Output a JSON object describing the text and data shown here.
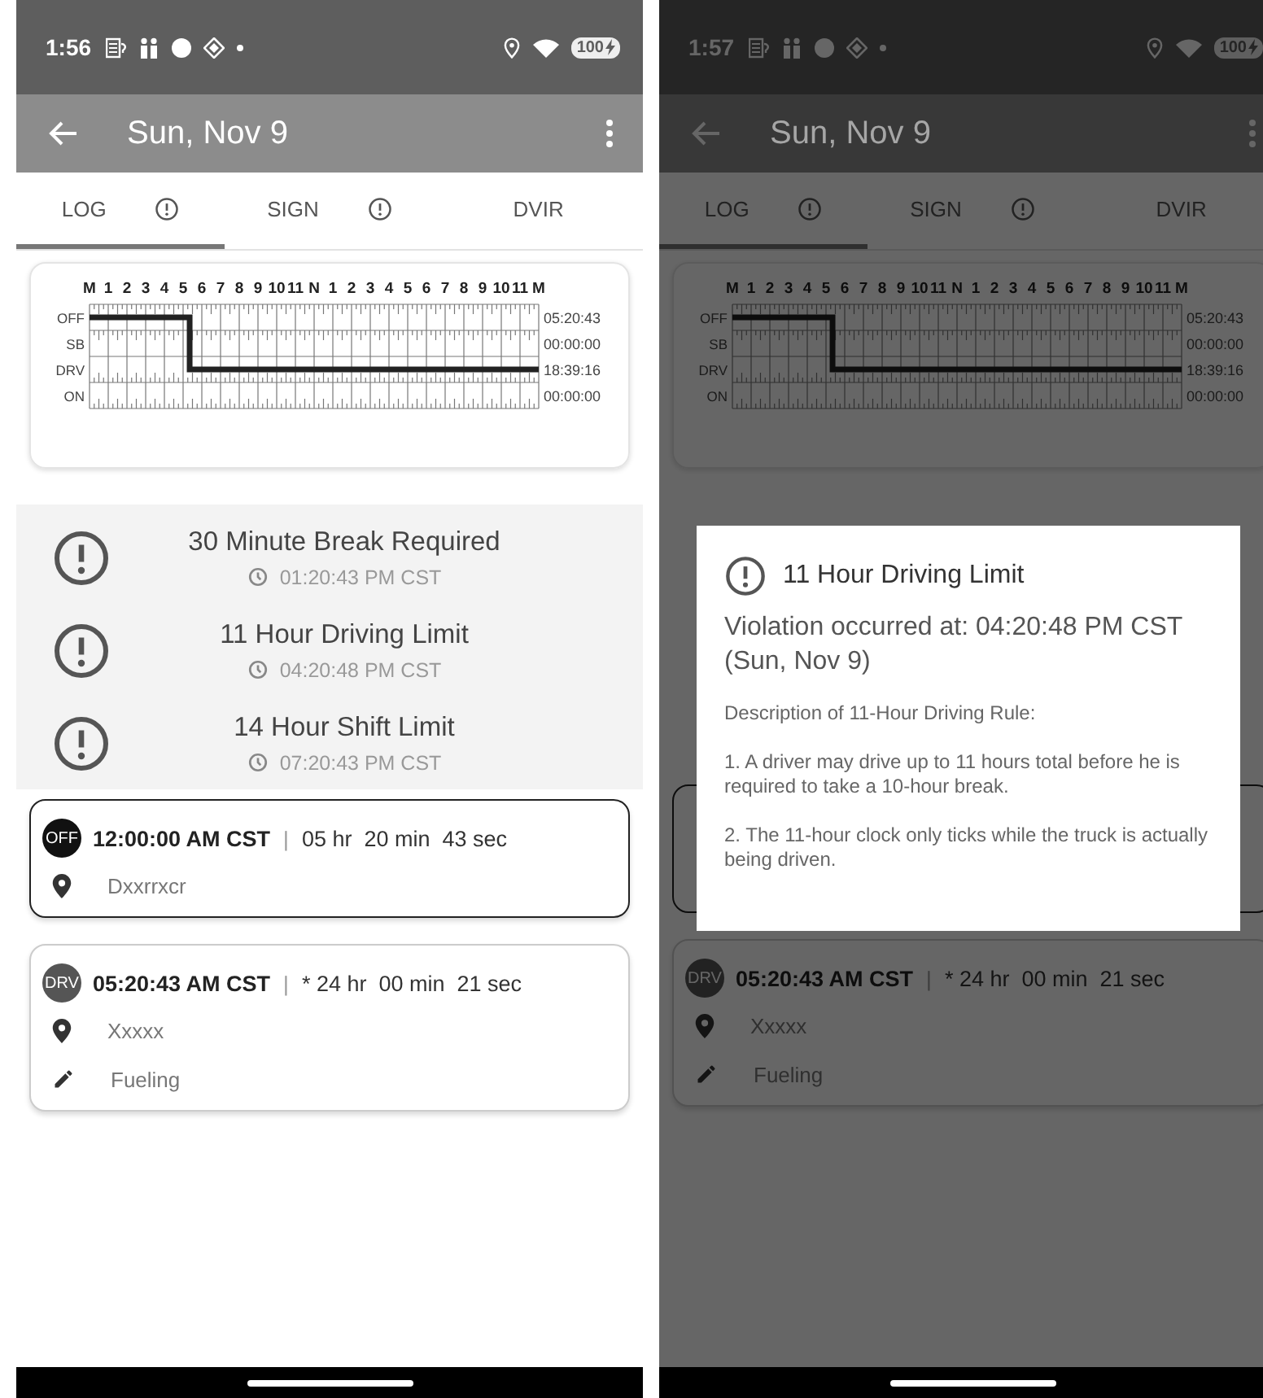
{
  "phones": [
    {
      "dimmed": false,
      "status_bar": {
        "time": "1:56",
        "battery": "100"
      },
      "app_bar": {
        "title": "Sun, Nov 9"
      },
      "tabs": [
        {
          "label": "LOG",
          "selected": true,
          "alert": true
        },
        {
          "label": "SIGN",
          "selected": false,
          "alert": true
        },
        {
          "label": "DVIR",
          "selected": false,
          "alert": false
        }
      ],
      "log_grid": {
        "hours": [
          "M",
          "1",
          "2",
          "3",
          "4",
          "5",
          "6",
          "7",
          "8",
          "9",
          "10",
          "11",
          "N",
          "1",
          "2",
          "3",
          "4",
          "5",
          "6",
          "7",
          "8",
          "9",
          "10",
          "11",
          "M"
        ],
        "rows": [
          {
            "label": "OFF",
            "total": "05:20:43"
          },
          {
            "label": "SB",
            "total": "00:00:00"
          },
          {
            "label": "DRV",
            "total": "18:39:16"
          },
          {
            "label": "ON",
            "total": "00:00:00"
          }
        ]
      },
      "violations": [
        {
          "title": "30 Minute Break Required",
          "time": "01:20:43 PM CST"
        },
        {
          "title": "11 Hour Driving Limit",
          "time": "04:20:48 PM CST"
        },
        {
          "title": "14 Hour Shift Limit",
          "time": "07:20:43 PM CST"
        }
      ],
      "entries": [
        {
          "status": "OFF",
          "color": "#111111",
          "selected": true,
          "time": "12:00:00 AM CST",
          "separator": "|",
          "duration": "05 hr  20 min  43 sec",
          "location": "Dxxrrxcr"
        },
        {
          "status": "DRV",
          "color": "#555555",
          "selected": false,
          "time": "05:20:43 AM CST",
          "separator": "|",
          "duration": "* 24 hr  00 min  21 sec",
          "location": "Xxxxx",
          "note": "Fueling"
        }
      ]
    },
    {
      "dimmed": true,
      "status_bar": {
        "time": "1:57",
        "battery": "100"
      },
      "app_bar": {
        "title": "Sun, Nov 9"
      },
      "tabs": [
        {
          "label": "LOG",
          "selected": true,
          "alert": true
        },
        {
          "label": "SIGN",
          "selected": false,
          "alert": true
        },
        {
          "label": "DVIR",
          "selected": false,
          "alert": false
        }
      ],
      "log_grid": {
        "hours": [
          "M",
          "1",
          "2",
          "3",
          "4",
          "5",
          "6",
          "7",
          "8",
          "9",
          "10",
          "11",
          "N",
          "1",
          "2",
          "3",
          "4",
          "5",
          "6",
          "7",
          "8",
          "9",
          "10",
          "11",
          "M"
        ],
        "rows": [
          {
            "label": "OFF",
            "total": "05:20:43"
          },
          {
            "label": "SB",
            "total": "00:00:00"
          },
          {
            "label": "DRV",
            "total": "18:39:16"
          },
          {
            "label": "ON",
            "total": "00:00:00"
          }
        ]
      },
      "entries": [
        {
          "status": "DRV",
          "color": "#555555",
          "selected": false,
          "time": "05:20:43 AM CST",
          "separator": "|",
          "duration": "* 24 hr  00 min  21 sec",
          "location": "Xxxxx",
          "note": "Fueling"
        }
      ],
      "dialog": {
        "title": "11 Hour Driving Limit",
        "occurred": "Violation occurred at: 04:20:48 PM CST (Sun, Nov 9)",
        "heading": "Description of 11-Hour Driving Rule:",
        "paragraphs": [
          "1. A driver may drive up to 11 hours total before he is required to take a 10-hour break.",
          "2. The 11-hour clock only ticks while the truck is actually being driven."
        ]
      }
    }
  ]
}
